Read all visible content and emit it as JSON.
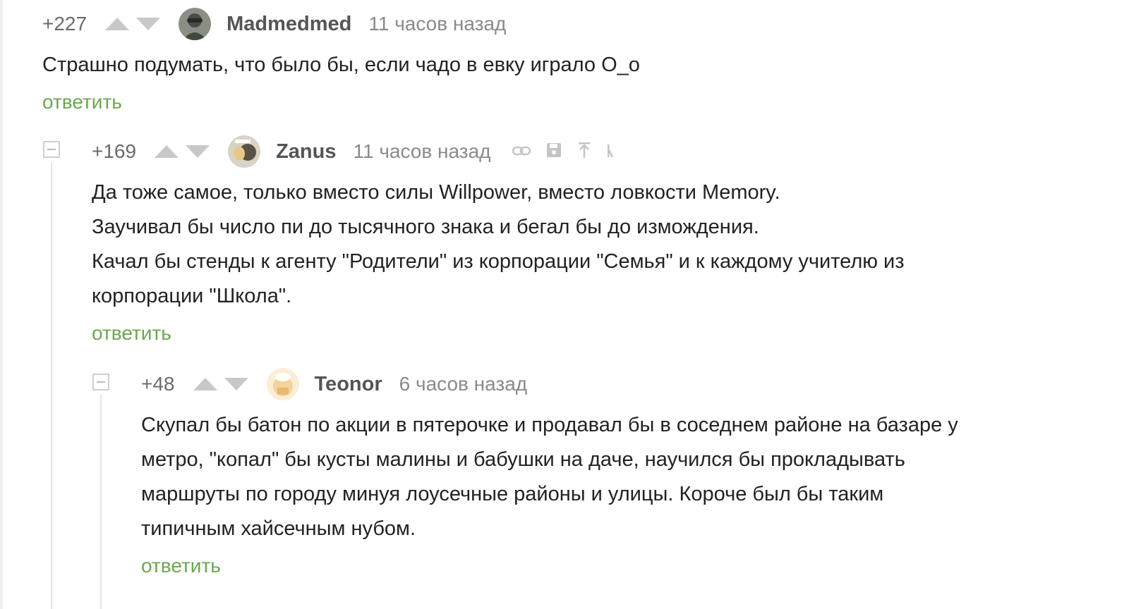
{
  "comments": [
    {
      "rating": "+227",
      "author": "Madmedmed",
      "time": "11 часов назад",
      "lines": [
        "Страшно подумать, что было бы, если чадо в евку играло О_о"
      ],
      "reply": "ответить"
    },
    {
      "rating": "+169",
      "author": "Zanus",
      "time": "11 часов назад",
      "lines": [
        "Да тоже самое, только вместо силы Willpower, вместо ловкости Memory.",
        "Заучивал бы число пи до тысячного знака и бегал бы до измождения.",
        "Качал бы стенды к агенту \"Родители\" из корпорации \"Семья\" и к каждому учителю из",
        "корпорации \"Школа\"."
      ],
      "reply": "ответить"
    },
    {
      "rating": "+48",
      "author": "Teonor",
      "time": "6 часов назад",
      "lines": [
        "Скупал бы батон по акции в пятерочке и продавал бы в соседнем районе на базаре у",
        "метро, \"копал\" бы кусты малины и бабушки на даче, научился бы прокладывать",
        "маршруты по городу минуя лоусечные районы и улицы. Короче был бы таким",
        "типичным хайсечным нубом."
      ],
      "reply": "ответить"
    }
  ],
  "icons": {
    "vote_up": "triangle-up",
    "vote_down": "triangle-down",
    "collapse": "minus-square",
    "tools": [
      "link-icon",
      "save-icon",
      "arrow-up-icon",
      "more-icon"
    ]
  },
  "colors": {
    "reply_link": "#6aa84f",
    "muted_text": "#8a8a8a",
    "icon_gray": "#c8c8c8"
  }
}
